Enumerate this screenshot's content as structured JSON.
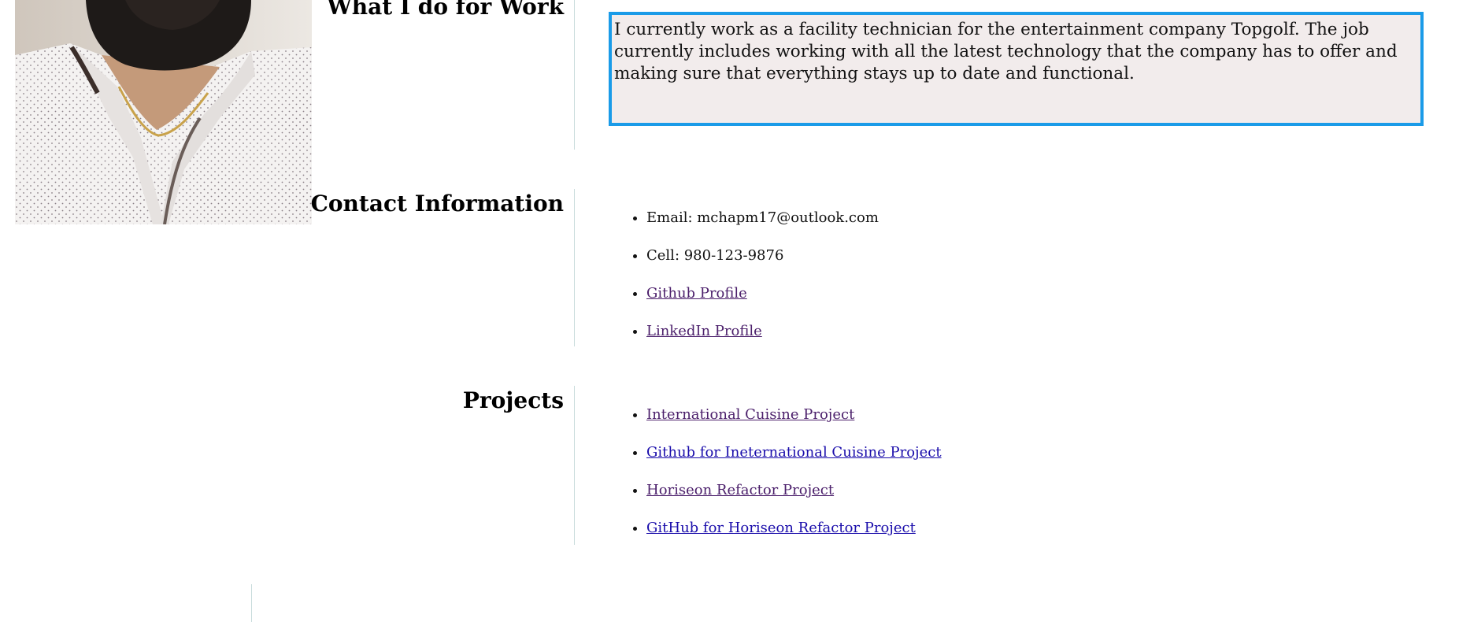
{
  "work": {
    "heading": "What I do for Work",
    "description": "I currently work as a facility technician for the entertainment company Topgolf. The job currently includes working with all the latest technology that the company has to offer and making sure that everything stays up to date and functional."
  },
  "contact": {
    "heading": "Contact Information",
    "email": "Email: mchapm17@outlook.com",
    "cell": "Cell: 980-123-9876",
    "github_link": "Github Profile",
    "linkedin_link": "LinkedIn Profile"
  },
  "projects": {
    "heading": "Projects",
    "items": [
      "International Cuisine Project",
      "Github for Ineternational Cuisine Project",
      "Horiseon Refactor Project",
      "GitHub for Horiseon Refactor Project"
    ]
  },
  "colors": {
    "focus_border": "#1a9be8",
    "textbox_bg": "#f2ecec",
    "visited_link": "#4b1f6b",
    "unvisited_link": "#1a0dab",
    "divider": "#c9dcdc"
  }
}
